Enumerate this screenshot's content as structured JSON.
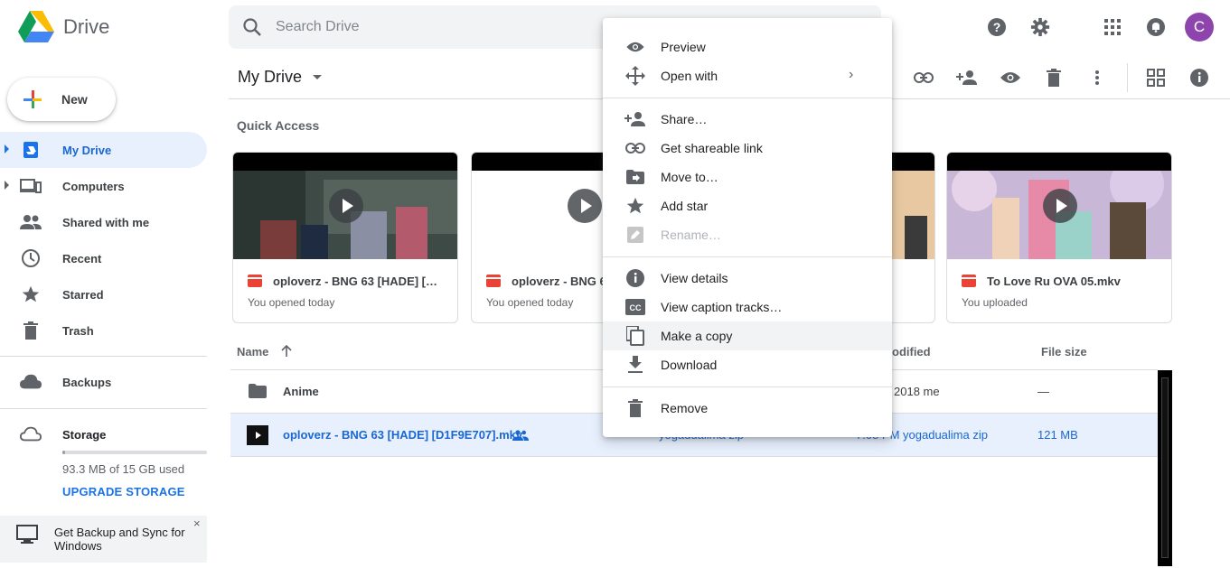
{
  "app": {
    "name": "Drive"
  },
  "search": {
    "placeholder": "Search Drive"
  },
  "sidebar": {
    "new_label": "New",
    "items": [
      {
        "label": "My Drive"
      },
      {
        "label": "Computers"
      },
      {
        "label": "Shared with me"
      },
      {
        "label": "Recent"
      },
      {
        "label": "Starred"
      },
      {
        "label": "Trash"
      },
      {
        "label": "Backups"
      },
      {
        "label": "Storage"
      }
    ],
    "storage_used": "93.3 MB of 15 GB used",
    "storage_fraction": 0.006,
    "upgrade_label": "UPGRADE STORAGE",
    "backup_banner": "Get Backup and Sync for Windows",
    "close_glyph": "×"
  },
  "user": {
    "initial": "C",
    "color": "#8e44ad"
  },
  "main": {
    "title": "My Drive",
    "quick_access_label": "Quick Access",
    "cards": [
      {
        "name": "oploverz - BNG 63 [HADE] [D1...",
        "sub": "You opened today"
      },
      {
        "name": "oploverz - BNG 63 [HADE] [D1...",
        "sub": "You opened today"
      },
      {
        "name": "",
        "sub": ""
      },
      {
        "name": "To Love Ru OVA 05.mkv",
        "sub": "You uploaded"
      }
    ],
    "columns": {
      "name": "Name",
      "modified": "odified",
      "size": "File size"
    },
    "rows": [
      {
        "name": "Anime",
        "owner": "",
        "modified": "2018 me",
        "size": "—"
      },
      {
        "name": "oploverz - BNG 63 [HADE] [D1F9E707].mkv",
        "owner": "yogadualima zip",
        "modified": "7:08 PM yogadualima zip",
        "size": "121 MB"
      }
    ]
  },
  "context_menu": {
    "items": [
      {
        "label": "Preview"
      },
      {
        "label": "Open with",
        "chevron": "›"
      },
      {
        "label": "Share…"
      },
      {
        "label": "Get shareable link"
      },
      {
        "label": "Move to…"
      },
      {
        "label": "Add star"
      },
      {
        "label": "Rename…"
      },
      {
        "label": "View details"
      },
      {
        "label": "View caption tracks…"
      },
      {
        "label": "Make a copy"
      },
      {
        "label": "Download"
      },
      {
        "label": "Remove"
      }
    ]
  }
}
